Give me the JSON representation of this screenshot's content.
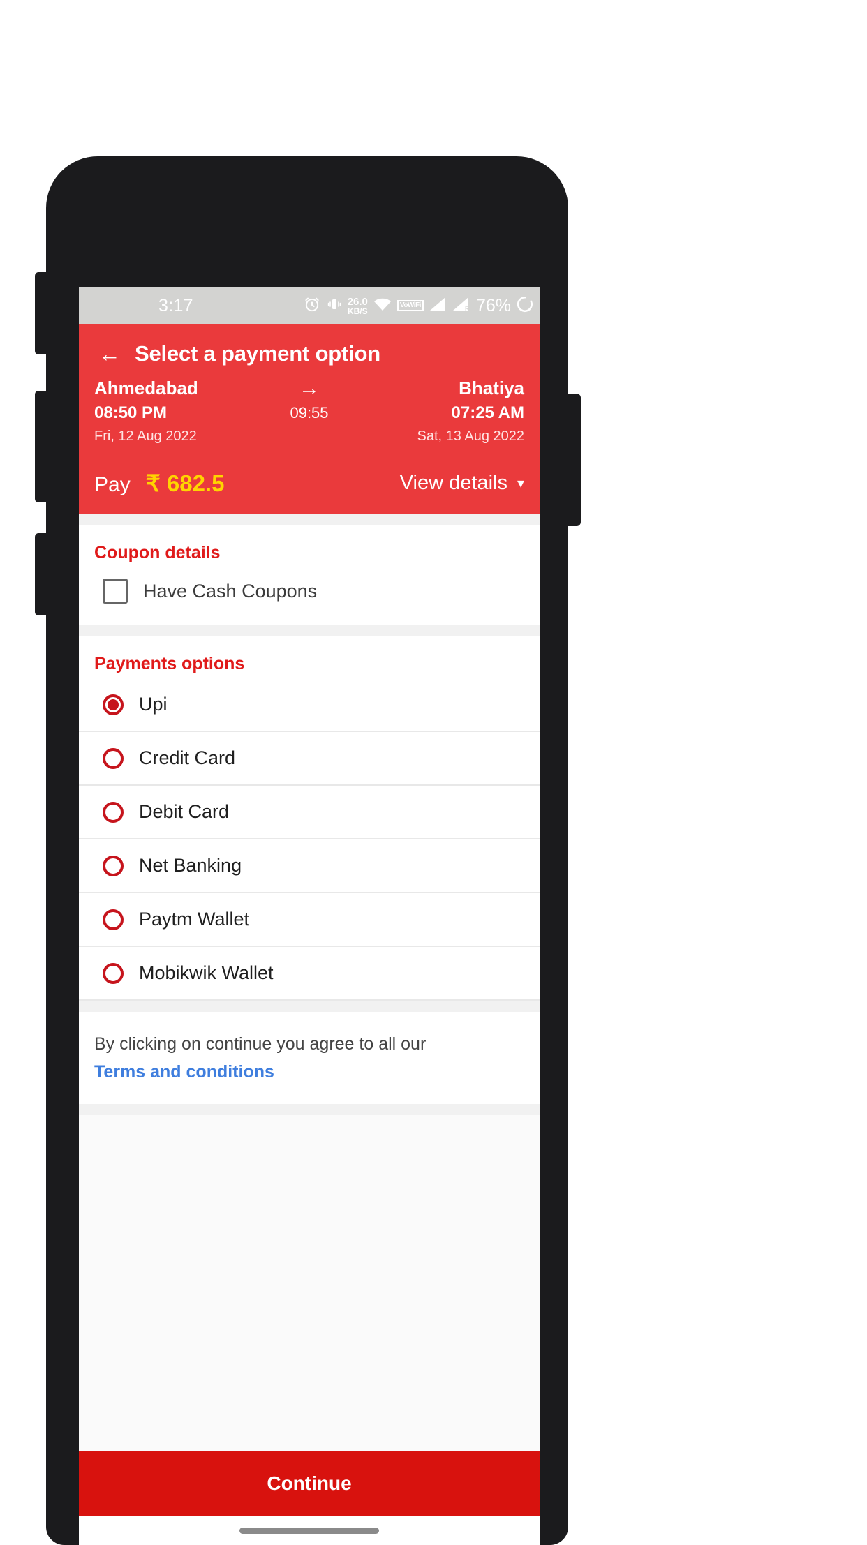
{
  "status_bar": {
    "time": "3:17",
    "network_speed": "26.0",
    "network_speed_unit": "KB/S",
    "vowifi_label": "VoWiFi",
    "battery": "76%",
    "icons": [
      "alarm-icon",
      "vibrate-icon",
      "wifi-icon",
      "vowifi-icon",
      "signal-1-icon",
      "signal-2-icon",
      "sync-icon"
    ]
  },
  "header": {
    "back_icon": "back-arrow-icon",
    "title": "Select a payment option",
    "journey": {
      "from_city": "Ahmedabad",
      "to_city": "Bhatiya",
      "arrow_icon": "arrow-right-icon",
      "departure_time": "08:50 PM",
      "duration": "09:55",
      "arrival_time": "07:25 AM",
      "departure_date": "Fri, 12 Aug 2022",
      "arrival_date": "Sat, 13 Aug 2022"
    },
    "pay_label": "Pay",
    "pay_amount": "₹ 682.5",
    "view_details_label": "View details",
    "view_details_icon": "chevron-down-icon"
  },
  "coupon": {
    "section_title": "Coupon details",
    "checkbox_label": "Have Cash Coupons",
    "checked": false
  },
  "payments": {
    "section_title": "Payments options",
    "options": [
      {
        "label": "Upi",
        "selected": true
      },
      {
        "label": "Credit Card",
        "selected": false
      },
      {
        "label": "Debit Card",
        "selected": false
      },
      {
        "label": "Net Banking",
        "selected": false
      },
      {
        "label": "Paytm Wallet",
        "selected": false
      },
      {
        "label": "Mobikwik Wallet",
        "selected": false
      }
    ]
  },
  "terms": {
    "text": "By clicking on continue you agree to all our",
    "link": "Terms and conditions"
  },
  "footer": {
    "continue_label": "Continue"
  },
  "colors": {
    "brand_red": "#ea3a3c",
    "accent_red": "#e01a1a",
    "button_red": "#d8120e",
    "radio_red": "#c6141c",
    "amount_yellow": "#ffd400",
    "link_blue": "#3f7ede",
    "status_bar_gray": "#d3d3d1"
  }
}
